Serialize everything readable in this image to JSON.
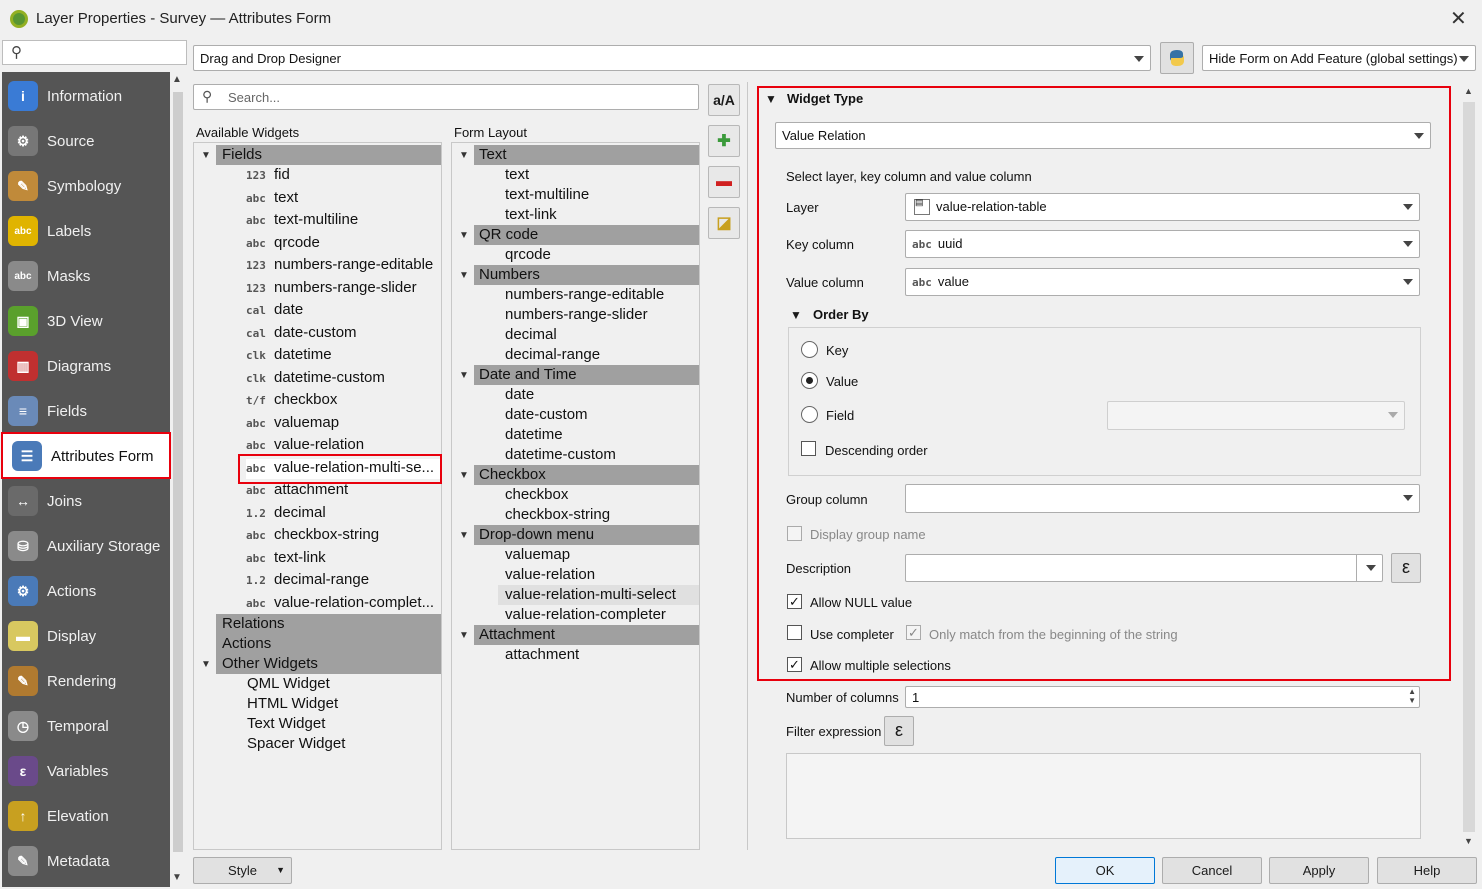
{
  "window": {
    "title": "Layer Properties - Survey — Attributes Form"
  },
  "sidebar": {
    "items": [
      {
        "label": "Information",
        "icon": "info-icon",
        "color": "#3a7bd5",
        "glyph": "i"
      },
      {
        "label": "Source",
        "icon": "gear-icon",
        "color": "#777777",
        "glyph": "⚙"
      },
      {
        "label": "Symbology",
        "icon": "paintbrush-icon",
        "color": "#c08a3a",
        "glyph": "✎"
      },
      {
        "label": "Labels",
        "icon": "labels-abc-icon",
        "color": "#e0b400",
        "glyph": "abc"
      },
      {
        "label": "Masks",
        "icon": "masks-abc-icon",
        "color": "#8a8a8a",
        "glyph": "abc"
      },
      {
        "label": "3D View",
        "icon": "cube-icon",
        "color": "#5aa02c",
        "glyph": "▣"
      },
      {
        "label": "Diagrams",
        "icon": "diagrams-icon",
        "color": "#c03030",
        "glyph": "▥"
      },
      {
        "label": "Fields",
        "icon": "fields-icon",
        "color": "#6a8ab8",
        "glyph": "≡"
      },
      {
        "label": "Attributes Form",
        "icon": "attributes-form-icon",
        "color": "#4a7ab8",
        "glyph": "☰"
      },
      {
        "label": "Joins",
        "icon": "joins-icon",
        "color": "#6a6a6a",
        "glyph": "↔"
      },
      {
        "label": "Auxiliary Storage",
        "icon": "database-icon",
        "color": "#8a8a8a",
        "glyph": "⛁"
      },
      {
        "label": "Actions",
        "icon": "actions-gear-icon",
        "color": "#4a7ab8",
        "glyph": "⚙"
      },
      {
        "label": "Display",
        "icon": "speech-bubble-icon",
        "color": "#d8c860",
        "glyph": "▬"
      },
      {
        "label": "Rendering",
        "icon": "brush-icon",
        "color": "#b07a30",
        "glyph": "✎"
      },
      {
        "label": "Temporal",
        "icon": "clock-icon",
        "color": "#8a8a8a",
        "glyph": "◷"
      },
      {
        "label": "Variables",
        "icon": "epsilon-icon",
        "color": "#6a4a8a",
        "glyph": "ε"
      },
      {
        "label": "Elevation",
        "icon": "elevation-icon",
        "color": "#c8a020",
        "glyph": "↑"
      },
      {
        "label": "Metadata",
        "icon": "metadata-icon",
        "color": "#8a8a8a",
        "glyph": "✎"
      }
    ]
  },
  "toolbar": {
    "designer_mode": "Drag and Drop Designer",
    "hide_form": "Hide Form on Add Feature (global settings)"
  },
  "available": {
    "search_placeholder": "Search...",
    "header": "Available Widgets",
    "fields_group": "Fields",
    "fields": [
      {
        "type": "123",
        "name": "fid"
      },
      {
        "type": "abc",
        "name": "text"
      },
      {
        "type": "abc",
        "name": "text-multiline"
      },
      {
        "type": "abc",
        "name": "qrcode"
      },
      {
        "type": "123",
        "name": "numbers-range-editable"
      },
      {
        "type": "123",
        "name": "numbers-range-slider"
      },
      {
        "type": "cal",
        "name": "date"
      },
      {
        "type": "cal",
        "name": "date-custom"
      },
      {
        "type": "clk",
        "name": "datetime"
      },
      {
        "type": "clk",
        "name": "datetime-custom"
      },
      {
        "type": "t/f",
        "name": "checkbox"
      },
      {
        "type": "abc",
        "name": "valuemap"
      },
      {
        "type": "abc",
        "name": "value-relation"
      },
      {
        "type": "abc",
        "name": "value-relation-multi-se..."
      },
      {
        "type": "abc",
        "name": "attachment"
      },
      {
        "type": "1.2",
        "name": "decimal"
      },
      {
        "type": "abc",
        "name": "checkbox-string"
      },
      {
        "type": "abc",
        "name": "text-link"
      },
      {
        "type": "1.2",
        "name": "decimal-range"
      },
      {
        "type": "abc",
        "name": "value-relation-complet..."
      }
    ],
    "relations": "Relations",
    "actions": "Actions",
    "other_widgets": "Other Widgets",
    "others": [
      "QML Widget",
      "HTML Widget",
      "Text Widget",
      "Spacer Widget"
    ]
  },
  "layout": {
    "header": "Form Layout",
    "rows": [
      {
        "kind": "group",
        "text": "Text"
      },
      {
        "kind": "item",
        "text": "text"
      },
      {
        "kind": "item",
        "text": "text-multiline"
      },
      {
        "kind": "item",
        "text": "text-link"
      },
      {
        "kind": "group",
        "text": "QR code"
      },
      {
        "kind": "item",
        "text": "qrcode"
      },
      {
        "kind": "group",
        "text": "Numbers"
      },
      {
        "kind": "item",
        "text": "numbers-range-editable"
      },
      {
        "kind": "item",
        "text": "numbers-range-slider"
      },
      {
        "kind": "item",
        "text": "decimal"
      },
      {
        "kind": "item",
        "text": "decimal-range"
      },
      {
        "kind": "group",
        "text": "Date and Time"
      },
      {
        "kind": "item",
        "text": "date"
      },
      {
        "kind": "item",
        "text": "date-custom"
      },
      {
        "kind": "item",
        "text": "datetime"
      },
      {
        "kind": "item",
        "text": "datetime-custom"
      },
      {
        "kind": "group",
        "text": "Checkbox"
      },
      {
        "kind": "item",
        "text": "checkbox"
      },
      {
        "kind": "item",
        "text": "checkbox-string"
      },
      {
        "kind": "group",
        "text": "Drop-down menu"
      },
      {
        "kind": "item",
        "text": "valuemap"
      },
      {
        "kind": "item",
        "text": "value-relation"
      },
      {
        "kind": "item",
        "text": "value-relation-multi-select"
      },
      {
        "kind": "item",
        "text": "value-relation-completer"
      },
      {
        "kind": "group",
        "text": "Attachment"
      },
      {
        "kind": "item",
        "text": "attachment"
      }
    ]
  },
  "widget": {
    "section_title": "Widget Type",
    "type": "Value Relation",
    "select_hint": "Select layer, key column and value column",
    "layer_label": "Layer",
    "layer_value": "value-relation-table",
    "key_label": "Key column",
    "key_type": "abc",
    "key_value": "uuid",
    "value_label": "Value column",
    "value_type": "abc",
    "value_value": "value",
    "order_by": "Order By",
    "order_key": "Key",
    "order_value": "Value",
    "order_field": "Field",
    "descending": "Descending order",
    "group_column": "Group column",
    "display_group_name": "Display group name",
    "description": "Description",
    "allow_null": "Allow NULL value",
    "use_completer": "Use completer",
    "only_match": "Only match from the beginning of the string",
    "allow_multiple": "Allow multiple selections",
    "num_columns_label": "Number of columns",
    "num_columns": "1",
    "filter_expression": "Filter expression"
  },
  "buttons": {
    "style": "Style",
    "ok": "OK",
    "cancel": "Cancel",
    "apply": "Apply",
    "help": "Help"
  },
  "colors": {
    "highlight": "#e8000d",
    "sidebar_bg": "#555555",
    "group_row_bg": "#a0a0a0"
  }
}
